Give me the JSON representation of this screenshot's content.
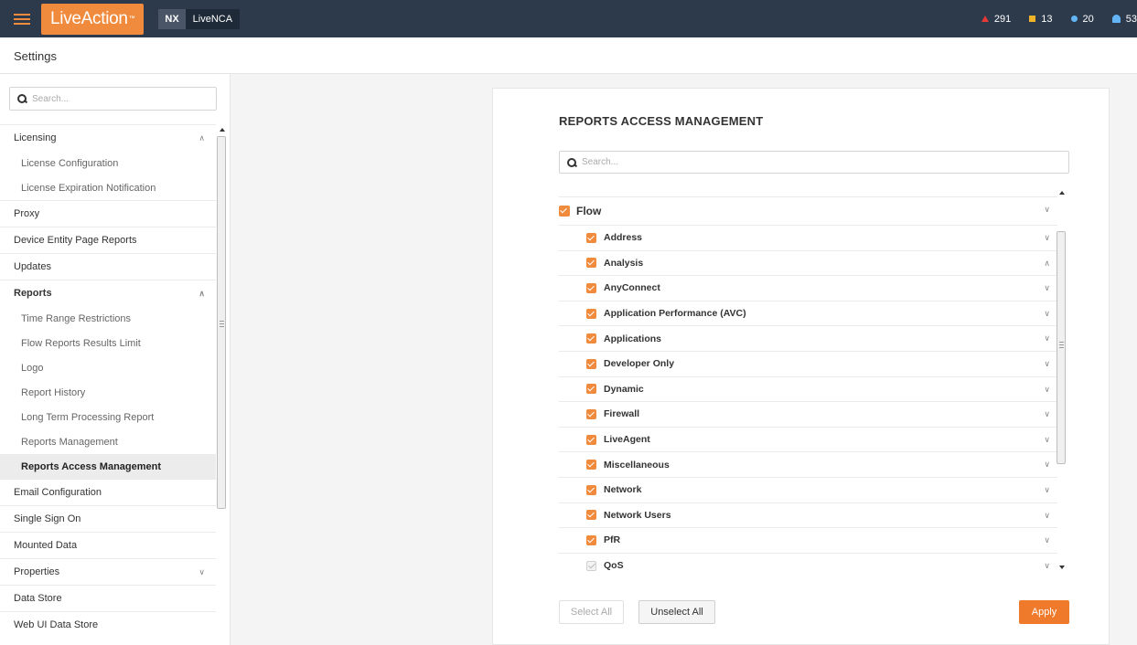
{
  "topbar": {
    "logo_text": "LiveAction",
    "logo_tm": "™",
    "badge_nx": "NX",
    "product": "LiveNCA",
    "alerts": [
      {
        "icon": "critical-triangle-icon",
        "count": "291",
        "color": "#e53935"
      },
      {
        "icon": "warning-square-icon",
        "count": "13",
        "color": "#f0b429"
      },
      {
        "icon": "info-dot-icon",
        "count": "20",
        "color": "#64b5f6"
      },
      {
        "icon": "bell-icon",
        "count": "53",
        "color": "#64b5f6"
      }
    ]
  },
  "header": {
    "title": "Settings"
  },
  "sidebar": {
    "search_placeholder": "Search...",
    "items": [
      {
        "label": "Licensing",
        "level": 0,
        "chevron": "up"
      },
      {
        "label": "License Configuration",
        "level": 1
      },
      {
        "label": "License Expiration Notification",
        "level": 1
      },
      {
        "label": "Proxy",
        "level": 0
      },
      {
        "label": "Device Entity Page Reports",
        "level": 0
      },
      {
        "label": "Updates",
        "level": 0
      },
      {
        "label": "Reports",
        "level": 0,
        "chevron": "up",
        "bold": true
      },
      {
        "label": "Time Range Restrictions",
        "level": 1
      },
      {
        "label": "Flow Reports Results Limit",
        "level": 1
      },
      {
        "label": "Logo",
        "level": 1
      },
      {
        "label": "Report History",
        "level": 1
      },
      {
        "label": "Long Term Processing Report",
        "level": 1
      },
      {
        "label": "Reports Management",
        "level": 1
      },
      {
        "label": "Reports Access Management",
        "level": 1,
        "selected": true
      },
      {
        "label": "Email Configuration",
        "level": 0
      },
      {
        "label": "Single Sign On",
        "level": 0
      },
      {
        "label": "Mounted Data",
        "level": 0
      },
      {
        "label": "Properties",
        "level": 0,
        "chevron": "down"
      },
      {
        "label": "Data Store",
        "level": 0
      },
      {
        "label": "Web UI Data Store",
        "level": 0
      }
    ]
  },
  "main": {
    "title": "REPORTS ACCESS MANAGEMENT",
    "search_placeholder": "Search...",
    "tree": {
      "parent": {
        "label": "Flow",
        "checked": true,
        "chevron": "down"
      },
      "children": [
        {
          "label": "Address",
          "checked": true,
          "chevron": "down"
        },
        {
          "label": "Analysis",
          "checked": true,
          "chevron": "up"
        },
        {
          "label": "AnyConnect",
          "checked": true,
          "chevron": "down"
        },
        {
          "label": "Application Performance (AVC)",
          "checked": true,
          "chevron": "down"
        },
        {
          "label": "Applications",
          "checked": true,
          "chevron": "down"
        },
        {
          "label": "Developer Only",
          "checked": true,
          "chevron": "down"
        },
        {
          "label": "Dynamic",
          "checked": true,
          "chevron": "down"
        },
        {
          "label": "Firewall",
          "checked": true,
          "chevron": "down"
        },
        {
          "label": "LiveAgent",
          "checked": true,
          "chevron": "down"
        },
        {
          "label": "Miscellaneous",
          "checked": true,
          "chevron": "down"
        },
        {
          "label": "Network",
          "checked": true,
          "chevron": "down"
        },
        {
          "label": "Network Users",
          "checked": true,
          "chevron": "down"
        },
        {
          "label": "PfR",
          "checked": true,
          "chevron": "down"
        },
        {
          "label": "QoS",
          "checked": false,
          "disabled": true,
          "chevron": "down"
        }
      ]
    },
    "buttons": {
      "select_all": "Select All",
      "unselect_all": "Unselect All",
      "apply": "Apply"
    }
  },
  "colors": {
    "accent": "#f07a2c",
    "topbar": "#2d3a4b"
  }
}
